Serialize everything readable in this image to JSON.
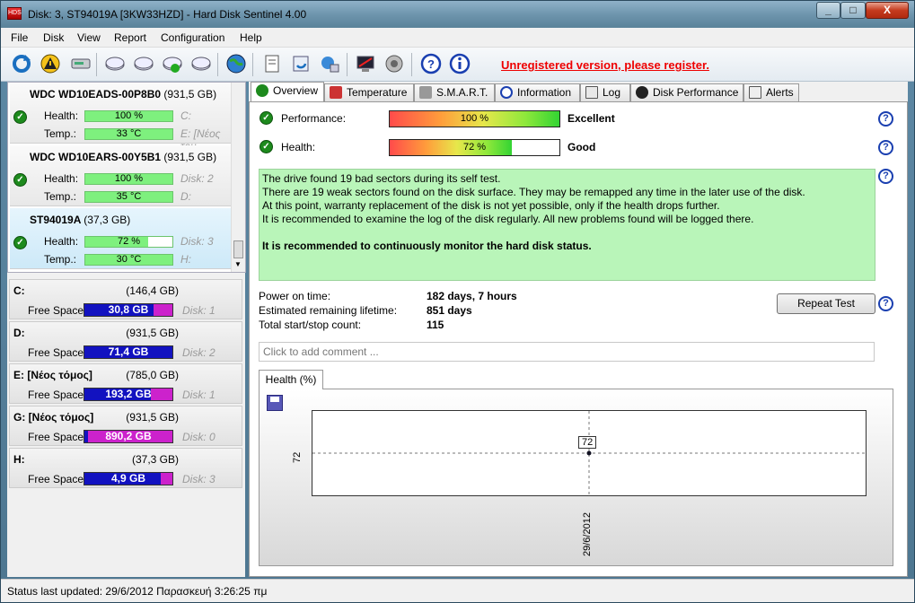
{
  "window": {
    "title": "Disk: 3, ST94019A [3KW33HZD]  -  Hard Disk Sentinel 4.00",
    "app_icon": "HDS",
    "min": "_",
    "max": "□",
    "close": "X"
  },
  "menu": [
    "File",
    "Disk",
    "View",
    "Report",
    "Configuration",
    "Help"
  ],
  "toolbar": {
    "icons": [
      "refresh-icon",
      "warning-icon",
      "disk-icon",
      "hdd-icon",
      "hdd-icon",
      "hdd-ok-icon",
      "hdd-icon",
      "globe-icon",
      "document-icon",
      "sync-icon",
      "network-icon",
      "monitor-icon",
      "speaker-icon",
      "help-icon",
      "info-icon"
    ],
    "unregistered": "Unregistered version, please register."
  },
  "disks": [
    {
      "name": "WDC WD10EADS-00P8B0",
      "size": "(931,5 GB)",
      "health_label": "Health:",
      "health": "100 %",
      "health_pct": 100,
      "temp_label": "Temp.:",
      "temp": "33 °C",
      "ref1": "C:",
      "ref2": "E: [Νέος τομ"
    },
    {
      "name": "WDC WD10EARS-00Y5B1",
      "size": "(931,5 GB)",
      "health_label": "Health:",
      "health": "100 %",
      "health_pct": 100,
      "temp_label": "Temp.:",
      "temp": "35 °C",
      "ref1": "Disk: 2",
      "ref2": "D:"
    },
    {
      "name": "ST94019A",
      "size": "(37,3 GB)",
      "health_label": "Health:",
      "health": "72 %",
      "health_pct": 72,
      "temp_label": "Temp.:",
      "temp": "30 °C",
      "ref1": "Disk: 3",
      "ref2": "H:"
    }
  ],
  "volumes": [
    {
      "name": "C:",
      "size": "(146,4 GB)",
      "free_label": "Free Space",
      "free": "30,8 GB",
      "free_pct": 79,
      "disk": "Disk: 1"
    },
    {
      "name": "D:",
      "size": "(931,5 GB)",
      "free_label": "Free Space",
      "free": "71,4 GB",
      "free_pct": 100,
      "disk": "Disk: 2"
    },
    {
      "name": "E: [Νέος τόμος]",
      "size": "(785,0 GB)",
      "free_label": "Free Space",
      "free": "193,2 GB",
      "free_pct": 75,
      "disk": "Disk: 1"
    },
    {
      "name": "G: [Νέος τόμος]",
      "size": "(931,5 GB)",
      "free_label": "Free Space",
      "free": "890,2 GB",
      "free_pct": 4,
      "disk": "Disk: 0"
    },
    {
      "name": "H:",
      "size": "(37,3 GB)",
      "free_label": "Free Space",
      "free": "4,9 GB",
      "free_pct": 87,
      "disk": "Disk: 3"
    }
  ],
  "tabs": [
    "Overview",
    "Temperature",
    "S.M.A.R.T.",
    "Information",
    "Log",
    "Disk Performance",
    "Alerts"
  ],
  "overview": {
    "performance_label": "Performance:",
    "performance": "100 %",
    "performance_pct": 100,
    "performance_verdict": "Excellent",
    "health_label": "Health:",
    "health": "72 %",
    "health_pct": 72,
    "health_verdict": "Good",
    "messages": [
      "The drive found 19 bad sectors during its self test.",
      "There are 19 weak sectors found on the disk surface. They may be remapped any time in the later use of the disk.",
      "At this point, warranty replacement of the disk is not yet possible, only if the health drops further.",
      "It is recommended to examine the log of the disk regularly. All new problems found will be logged there."
    ],
    "recommendation": "It is recommended to continuously monitor the hard disk status.",
    "power_on_label": "Power on time:",
    "power_on": "182 days, 7 hours",
    "lifetime_label": "Estimated remaining lifetime:",
    "lifetime": "851 days",
    "startstop_label": "Total start/stop count:",
    "startstop": "115",
    "repeat_button": "Repeat Test",
    "comment_placeholder": "Click to add comment ..."
  },
  "chart_data": {
    "type": "line",
    "title": "Health (%)",
    "x": [
      "29/6/2012"
    ],
    "series": [
      {
        "values": [
          72
        ]
      }
    ],
    "y_tick": "72",
    "point_label": "72"
  },
  "status": "Status last updated: 29/6/2012 Παρασκευή 3:26:25 πμ"
}
